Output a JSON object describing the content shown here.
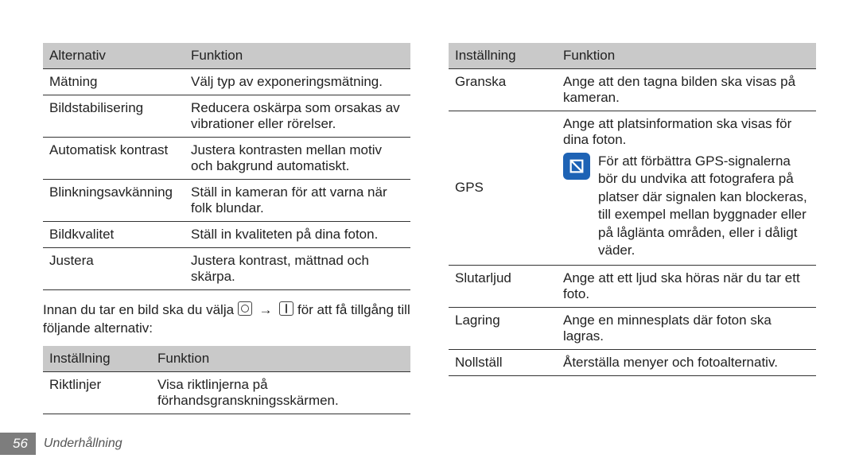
{
  "left": {
    "table1": {
      "headers": [
        "Alternativ",
        "Funktion"
      ],
      "rows": [
        {
          "c1": "Mätning",
          "c2": "Välj typ av exponeringsmätning."
        },
        {
          "c1": "Bildstabilisering",
          "c2": "Reducera oskärpa som orsakas av vibrationer eller rörelser."
        },
        {
          "c1": "Automatisk kontrast",
          "c2": "Justera kontrasten mellan motiv och bakgrund automatiskt."
        },
        {
          "c1": "Blinkningsavkänning",
          "c2": "Ställ in kameran för att varna när folk blundar."
        },
        {
          "c1": "Bildkvalitet",
          "c2": "Ställ in kvaliteten på dina foton."
        },
        {
          "c1": "Justera",
          "c2": "Justera kontrast, mättnad och skärpa."
        }
      ]
    },
    "para_before": "Innan du tar en bild ska du välja ",
    "para_after": " för att få tillgång till följande alternativ:",
    "arrow": "→",
    "table2": {
      "headers": [
        "Inställning",
        "Funktion"
      ],
      "rows": [
        {
          "c1": "Riktlinjer",
          "c2": "Visa riktlinjerna på förhandsgranskningsskärmen."
        }
      ]
    }
  },
  "right": {
    "table": {
      "headers": [
        "Inställning",
        "Funktion"
      ],
      "row_granska": {
        "c1": "Granska",
        "c2": "Ange att den tagna bilden ska visas på kameran."
      },
      "row_gps": {
        "c1": "GPS",
        "lead": "Ange att platsinformation ska visas för dina foton.",
        "note": "För att förbättra GPS-signalerna bör du undvika att fotografera på platser där signalen kan blockeras, till exempel mellan byggnader eller på låglänta områden, eller i dåligt väder."
      },
      "row_slutarljud": {
        "c1": "Slutarljud",
        "c2": "Ange att ett ljud ska höras när du tar ett foto."
      },
      "row_lagring": {
        "c1": "Lagring",
        "c2": "Ange en minnesplats där foton ska lagras."
      },
      "row_nollstall": {
        "c1": "Nollställ",
        "c2": "Återställa menyer och fotoalternativ."
      }
    }
  },
  "footer": {
    "page": "56",
    "section": "Underhållning"
  }
}
